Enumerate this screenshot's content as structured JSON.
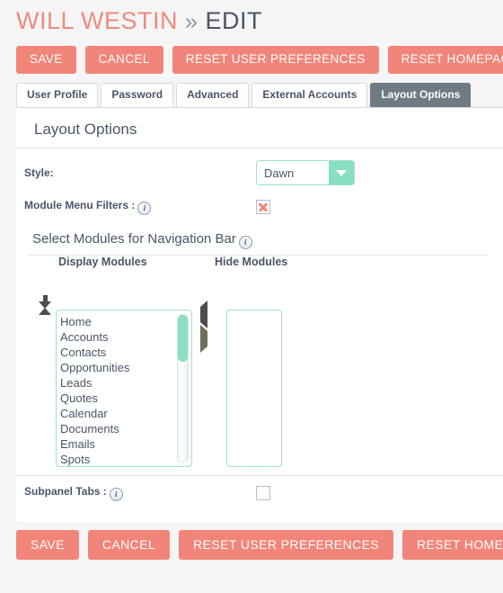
{
  "header": {
    "record_name": "WILL WESTIN",
    "separator": "»",
    "action": "EDIT"
  },
  "top_actions": [
    {
      "label": "SAVE",
      "name": "save-button"
    },
    {
      "label": "CANCEL",
      "name": "cancel-button"
    },
    {
      "label": "RESET USER PREFERENCES",
      "name": "reset-user-preferences-button"
    },
    {
      "label": "RESET HOMEPAGE",
      "name": "reset-homepage-button"
    }
  ],
  "tabs": [
    {
      "label": "User Profile",
      "active": false
    },
    {
      "label": "Password",
      "active": false
    },
    {
      "label": "Advanced",
      "active": false
    },
    {
      "label": "External Accounts",
      "active": false
    },
    {
      "label": "Layout Options",
      "active": true
    }
  ],
  "panel": {
    "title": "Layout Options",
    "style_field": {
      "label": "Style:",
      "value": "Dawn",
      "options": [
        "Dawn"
      ]
    },
    "module_menu_filters": {
      "label": "Module Menu Filters :",
      "checked": true,
      "info_icon": "info-icon"
    },
    "subsection": {
      "title": "Select Modules for Navigation Bar",
      "info_icon": "info-icon"
    },
    "dual_list": {
      "left_header": "Display Modules",
      "right_header": "Hide Modules",
      "display_modules": [
        "Home",
        "Accounts",
        "Contacts",
        "Opportunities",
        "Leads",
        "Quotes",
        "Calendar",
        "Documents",
        "Emails",
        "Spots"
      ],
      "hide_modules": [],
      "move_up_icon": "arrow-up-icon",
      "move_down_icon": "arrow-down-icon",
      "move_left_icon": "arrow-left-icon",
      "move_right_icon": "arrow-right-icon"
    },
    "subpanel_tabs": {
      "label": "Subpanel Tabs :",
      "checked": false,
      "info_icon": "info-icon"
    }
  },
  "bottom_actions": [
    {
      "label": "SAVE",
      "name": "save-button"
    },
    {
      "label": "CANCEL",
      "name": "cancel-button"
    },
    {
      "label": "RESET USER PREFERENCES",
      "name": "reset-user-preferences-button"
    },
    {
      "label": "RESET HOMEPAGE",
      "name": "reset-homepage-button"
    }
  ],
  "colors": {
    "accent": "#f28579",
    "mint": "#88dfc4",
    "tab_active_bg": "#6e7a84",
    "text": "#4b5568",
    "page_bg": "#f5f5f5"
  }
}
